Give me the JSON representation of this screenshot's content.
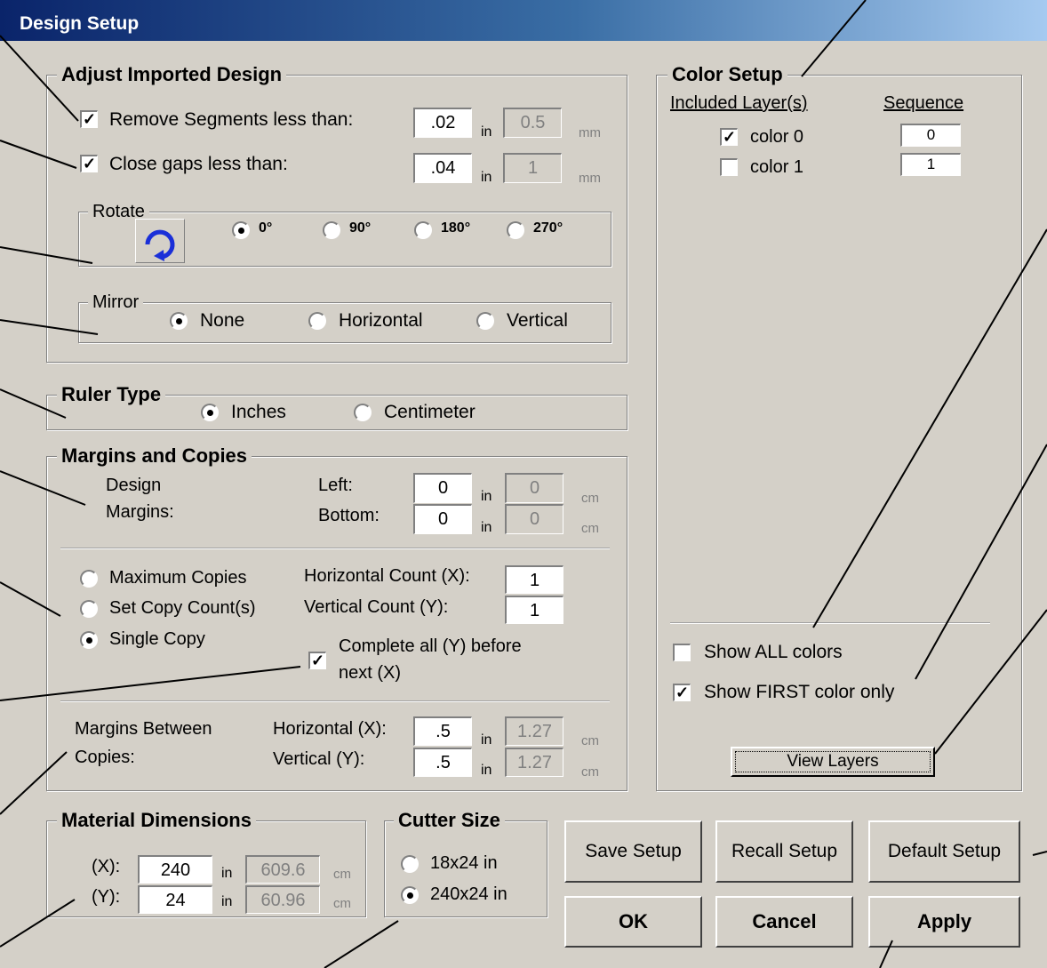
{
  "window": {
    "title": "Design Setup"
  },
  "adjust": {
    "title": "Adjust Imported Design",
    "remove_label": "Remove Segments less than:",
    "remove_value": ".02",
    "remove_in": "in",
    "remove_mm_value": "0.5",
    "remove_mm": "mm",
    "close_label": "Close gaps less than:",
    "close_value": ".04",
    "close_in": "in",
    "close_mm_value": "1",
    "close_mm": "mm",
    "rotate": {
      "title": "Rotate",
      "options": [
        "0°",
        "90°",
        "180°",
        "270°"
      ],
      "selected": "0°"
    },
    "mirror": {
      "title": "Mirror",
      "options": [
        "None",
        "Horizontal",
        "Vertical"
      ],
      "selected": "None"
    }
  },
  "ruler": {
    "title": "Ruler Type",
    "options": [
      "Inches",
      "Centimeter"
    ],
    "selected": "Inches"
  },
  "margins": {
    "title": "Margins and Copies",
    "design_label_1": "Design",
    "design_label_2": "Margins:",
    "left_label": "Left:",
    "left_value": "0",
    "left_cm_value": "0",
    "bottom_label": "Bottom:",
    "bottom_value": "0",
    "bottom_cm_value": "0",
    "in": "in",
    "cm": "cm",
    "copy_options": [
      "Maximum Copies",
      "Set Copy Count(s)",
      "Single Copy"
    ],
    "copy_selected": "Single Copy",
    "hcount_label": "Horizontal Count (X):",
    "hcount_value": "1",
    "vcount_label": "Vertical Count (Y):",
    "vcount_value": "1",
    "complete_label_1": "Complete all (Y) before",
    "complete_label_2": "next (X)",
    "between_label_1": "Margins Between",
    "between_label_2": "Copies:",
    "h_label": "Horizontal (X):",
    "h_value": ".5",
    "h_cm_value": "1.27",
    "v_label": "Vertical (Y):",
    "v_value": ".5",
    "v_cm_value": "1.27"
  },
  "material": {
    "title": "Material Dimensions",
    "x_label": "(X):",
    "x_value": "240",
    "x_cm_value": "609.6",
    "y_label": "(Y):",
    "y_value": "24",
    "y_cm_value": "60.96",
    "in": "in",
    "cm": "cm"
  },
  "cutter": {
    "title": "Cutter Size",
    "options": [
      "18x24 in",
      "240x24 in"
    ],
    "selected": "240x24 in"
  },
  "color": {
    "title": "Color Setup",
    "col_layers": "Included Layer(s)",
    "col_sequence": "Sequence",
    "layers": [
      {
        "name": "color 0",
        "checked": true,
        "seq": "0"
      },
      {
        "name": "color 1",
        "checked": false,
        "seq": "1"
      }
    ],
    "show_all_label": "Show ALL colors",
    "show_all_checked": false,
    "show_first_label": "Show FIRST color only",
    "show_first_checked": true,
    "view_layers_label": "View Layers"
  },
  "buttons": {
    "save": "Save Setup",
    "recall": "Recall Setup",
    "default": "Default Setup",
    "ok": "OK",
    "cancel": "Cancel",
    "apply": "Apply"
  },
  "check_mark": "✓"
}
